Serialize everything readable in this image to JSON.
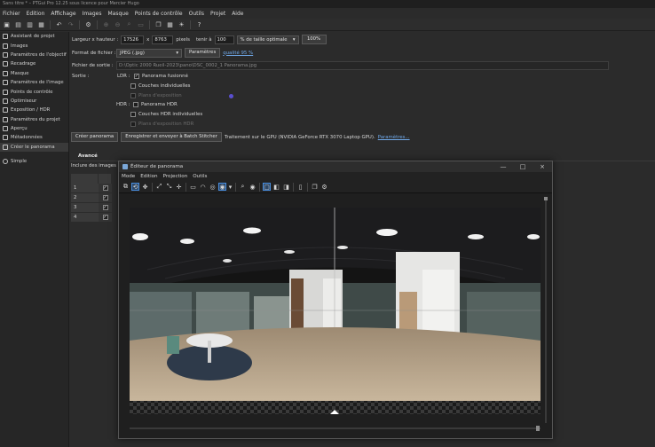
{
  "window": {
    "title": "Sans titre * – PTGui Pro 12.25 sous licence pour Mercier Hugo"
  },
  "menubar": [
    "Fichier",
    "Edition",
    "Affichage",
    "Images",
    "Masque",
    "Points de contrôle",
    "Outils",
    "Projet",
    "Aide"
  ],
  "toolbar_icons": [
    "new-project-icon",
    "open-icon",
    "save-icon",
    "save-as-icon",
    "undo-icon",
    "redo-icon",
    "settings-icon",
    "zoom-in-icon",
    "zoom-out-icon",
    "search-icon",
    "image-icon",
    "window-icon",
    "grid-icon",
    "lightbulb-icon",
    "help-icon"
  ],
  "sidebar": {
    "items": [
      {
        "label": "Assistant de projet",
        "icon": "wizard-icon"
      },
      {
        "label": "Images",
        "icon": "images-icon"
      },
      {
        "label": "Paramètres de l'objectif",
        "icon": "lens-icon"
      },
      {
        "label": "Recadrage",
        "icon": "crop-icon"
      },
      {
        "label": "Masque",
        "icon": "mask-icon"
      },
      {
        "label": "Paramètres de l'image",
        "icon": "image-params-icon"
      },
      {
        "label": "Points de contrôle",
        "icon": "control-points-icon"
      },
      {
        "label": "Optimiseur",
        "icon": "optimizer-icon"
      },
      {
        "label": "Exposition / HDR",
        "icon": "exposure-icon"
      },
      {
        "label": "Paramètres du projet",
        "icon": "project-params-icon"
      },
      {
        "label": "Aperçu",
        "icon": "preview-icon"
      },
      {
        "label": "Métadonnées",
        "icon": "metadata-icon"
      },
      {
        "label": "Créer le panorama",
        "icon": "create-panorama-icon"
      }
    ],
    "simple_label": "Simple"
  },
  "create": {
    "size_label": "Largeur x hauteur :",
    "width": "17526",
    "x_sep": "x",
    "height": "8763",
    "pixels_label": "pixels",
    "tenir_label": "tenir à",
    "percent_value": "100",
    "size_mode": "% de taille optimale",
    "percent_button": "100%",
    "format_label": "Format de fichier :",
    "format_value": "JPEG (.jpg)",
    "params_button": "Paramètres",
    "quality_link": "qualité 95 %",
    "output_label": "Fichier de sortie :",
    "output_path": "D:\\Optic 2000 Rueil-2023\\pano\\DSC_0002_1 Panorama.jpg",
    "sortie_label": "Sortie :",
    "ldr_label": "LDR :",
    "hdr_label": "HDR :",
    "ldr_options": [
      {
        "label": "Panorama fusionné",
        "checked": "✓",
        "disabled": false
      },
      {
        "label": "Couches individuelles",
        "checked": "",
        "disabled": false
      },
      {
        "label": "Plans d'exposition",
        "checked": "",
        "disabled": true
      }
    ],
    "hdr_options": [
      {
        "label": "Panorama HDR",
        "checked": "",
        "disabled": false
      },
      {
        "label": "Couches HDR individuelles",
        "checked": "",
        "disabled": false
      },
      {
        "label": "Plans d'exposition HDR",
        "checked": "",
        "disabled": true
      }
    ],
    "create_button": "Créer panorama",
    "batch_button": "Enregistrer et envoyer à Batch Stitcher",
    "gpu_text": "Traitement sur le GPU (NVIDIA GeForce RTX 3070 Laptop GPU).",
    "gpu_params_link": "Paramètres..."
  },
  "advanced_tab": "Avancé",
  "images_table": {
    "header": "Inclure des images :",
    "rows": [
      {
        "num": "1",
        "checked": "✓"
      },
      {
        "num": "2",
        "checked": "✓"
      },
      {
        "num": "3",
        "checked": "✓"
      },
      {
        "num": "4",
        "checked": "✓"
      }
    ]
  },
  "editor": {
    "title": "Éditeur de panorama",
    "window_controls": [
      "—",
      "□",
      "×"
    ],
    "menu": [
      "Mode",
      "Edition",
      "Projection",
      "Outils"
    ],
    "tools": [
      "arrange-icon",
      "rotate-icon",
      "move-icon",
      "fit-icon",
      "shrink-icon",
      "center-icon",
      "rect-icon",
      "curve-icon",
      "select-icon",
      "sphere-icon",
      "zoom-icon",
      "eye-icon",
      "frame-icon",
      "split-icon",
      "mirror-icon",
      "cube-icon",
      "layers-icon",
      "gear-icon"
    ]
  },
  "colors": {
    "accent": "#4a8fe0",
    "link": "#6fa8e8",
    "bg": "#2b2b2b",
    "sidebar": "#262626"
  }
}
